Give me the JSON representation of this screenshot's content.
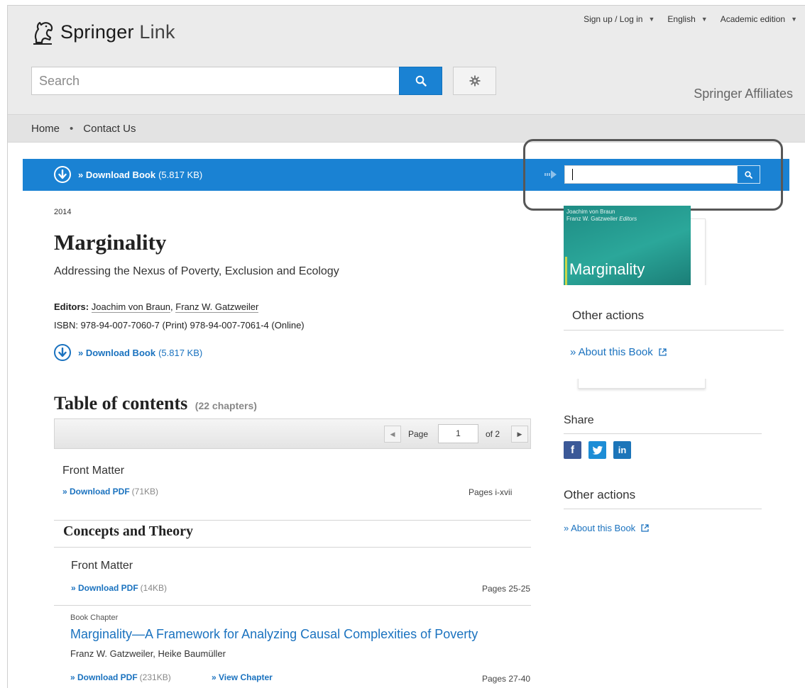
{
  "header": {
    "brand_main": "Springer",
    "brand_sub": "Link",
    "topnav": {
      "signup": "Sign up / Log in",
      "language": "English",
      "edition": "Academic edition"
    },
    "search_placeholder": "Search",
    "affiliates": "Springer Affiliates"
  },
  "breadcrumb": {
    "home": "Home",
    "separator": "•",
    "contact": "Contact Us"
  },
  "download_bar": {
    "label": "» Download Book",
    "size": "(5.817 KB)",
    "search_value": ""
  },
  "book": {
    "year": "2014",
    "title": "Marginality",
    "subtitle": "Addressing the Nexus of Poverty, Exclusion and Ecology",
    "editors_label": "Editors:",
    "editor_1": "Joachim von Braun",
    "editor_sep": ",",
    "editor_2": "Franz W. Gatzweiler",
    "isbn": "ISBN: 978-94-007-7060-7 (Print) 978-94-007-7061-4 (Online)",
    "download_label": "» Download Book",
    "download_size": "(5.817 KB)"
  },
  "toc": {
    "heading": "Table of contents",
    "count": "(22 chapters)",
    "pager": {
      "page_label": "Page",
      "page_value": "1",
      "of_label": "of 2"
    },
    "items": [
      {
        "title": "Front Matter",
        "link": "» Download PDF",
        "size": "(71KB)",
        "pages": "Pages i-xvii"
      }
    ],
    "part": {
      "title": "Concepts and Theory",
      "front_matter": {
        "title": "Front Matter",
        "link": "» Download PDF",
        "size": "(14KB)",
        "pages": "Pages 25-25"
      },
      "chapter": {
        "type": "Book Chapter",
        "title": "Marginality—A Framework for Analyzing Causal Complexities of Poverty",
        "authors": "Franz W. Gatzweiler, Heike Baumüller",
        "pdf_link": "» Download PDF",
        "pdf_size": "(231KB)",
        "view_link": "» View Chapter",
        "pages": "Pages 27-40"
      }
    }
  },
  "sidebar": {
    "cover_editors_line1": "Joachim von Braun",
    "cover_editors_line2": "Franz W. Gatzweiler",
    "cover_editors_suffix": "Editors",
    "cover_title": "Marginality",
    "other_actions_1": "Other actions",
    "about_1": "» About this Book",
    "share": "Share",
    "social": {
      "facebook": "f",
      "twitter": "t",
      "linkedin": "in"
    },
    "other_actions_2": "Other actions",
    "about_2": "» About this Book"
  },
  "colors": {
    "accent_blue": "#1a82d3",
    "link_blue": "#1a72bf",
    "header_gray": "#ebebeb",
    "cover_teal": "#2ba79a"
  }
}
